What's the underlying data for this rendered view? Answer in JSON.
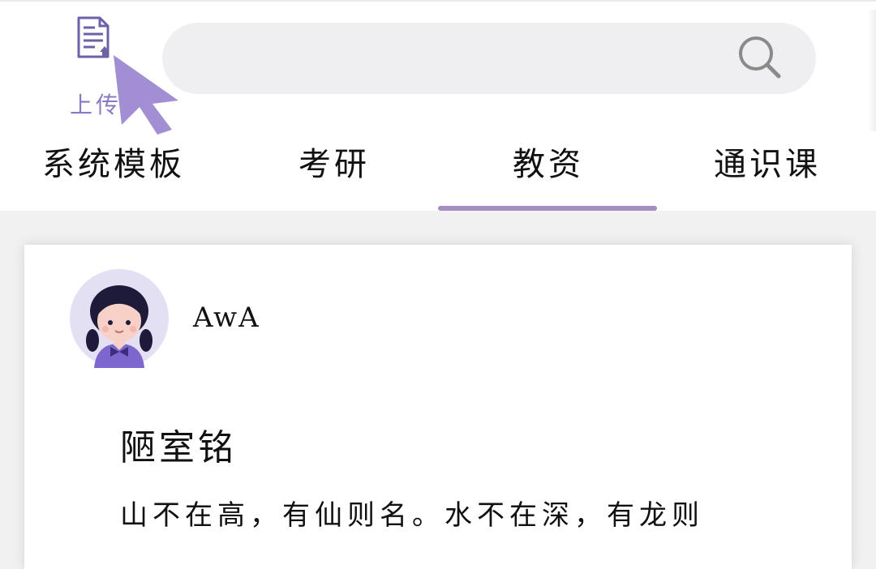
{
  "header": {
    "upload": {
      "label": "上传",
      "icon": "document-upload-icon"
    },
    "search": {
      "placeholder": "",
      "icon": "search-icon"
    },
    "cursor_icon": "pointer-cursor-icon",
    "accent_color": "#a38dc3"
  },
  "tabs": [
    {
      "label": "系统模板",
      "active": false
    },
    {
      "label": "考研",
      "active": false
    },
    {
      "label": "教资",
      "active": true
    },
    {
      "label": "通识课",
      "active": false
    }
  ],
  "post": {
    "author": {
      "name": "AwA",
      "avatar": "avatar-girl-icon"
    },
    "title": "陋室铭",
    "body": "山不在高，有仙则名。水不在深，有龙则"
  }
}
